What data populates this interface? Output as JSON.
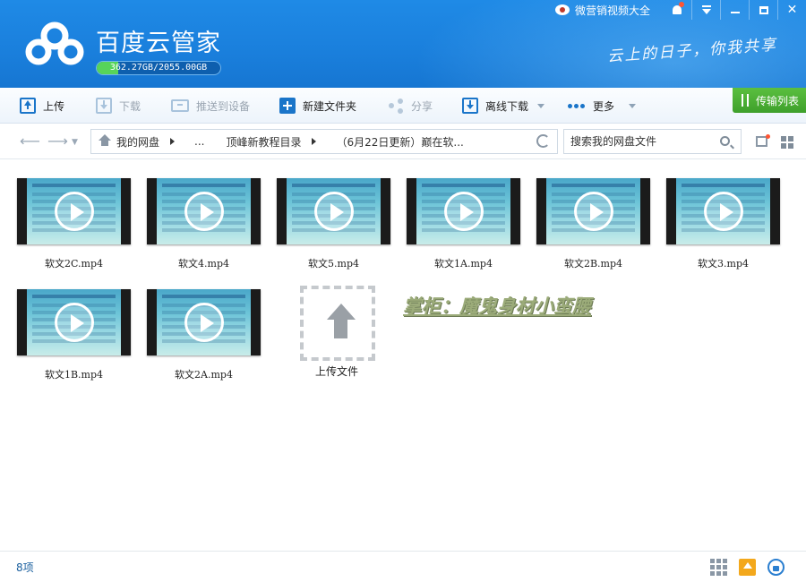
{
  "header": {
    "app_title": "百度云管家",
    "quota": {
      "text": "362.27GB/2055.00GB",
      "used_fraction": 0.176
    },
    "slogan": "云上的日子，你我共享",
    "promo_label": "微营销视频大全"
  },
  "toolbar": {
    "upload": "上传",
    "download": "下载",
    "push": "推送到设备",
    "new_folder": "新建文件夹",
    "share": "分享",
    "offline": "离线下载",
    "more": "更多",
    "transfer_list": "传输列表"
  },
  "addressbar": {
    "crumbs": [
      "我的网盘",
      "...",
      "顶峰新教程目录",
      "（6月22日更新）巅在软..."
    ],
    "search_placeholder": "搜索我的网盘文件"
  },
  "files": [
    {
      "name": "软文2C.mp4"
    },
    {
      "name": "软文4.mp4"
    },
    {
      "name": "软文5.mp4"
    },
    {
      "name": "软文1A.mp4"
    },
    {
      "name": "软文2B.mp4"
    },
    {
      "name": "软文3.mp4"
    },
    {
      "name": "软文1B.mp4"
    },
    {
      "name": "软文2A.mp4"
    }
  ],
  "upload_tile_label": "上传文件",
  "watermark": "掌柜：魔鬼身材小蛮腰",
  "status": {
    "count": "8项"
  },
  "colors": {
    "header_blue": "#1a7fdc",
    "transfer_green": "#4fb236",
    "quota_green": "#57d45a",
    "watermark": "#9bab79"
  }
}
